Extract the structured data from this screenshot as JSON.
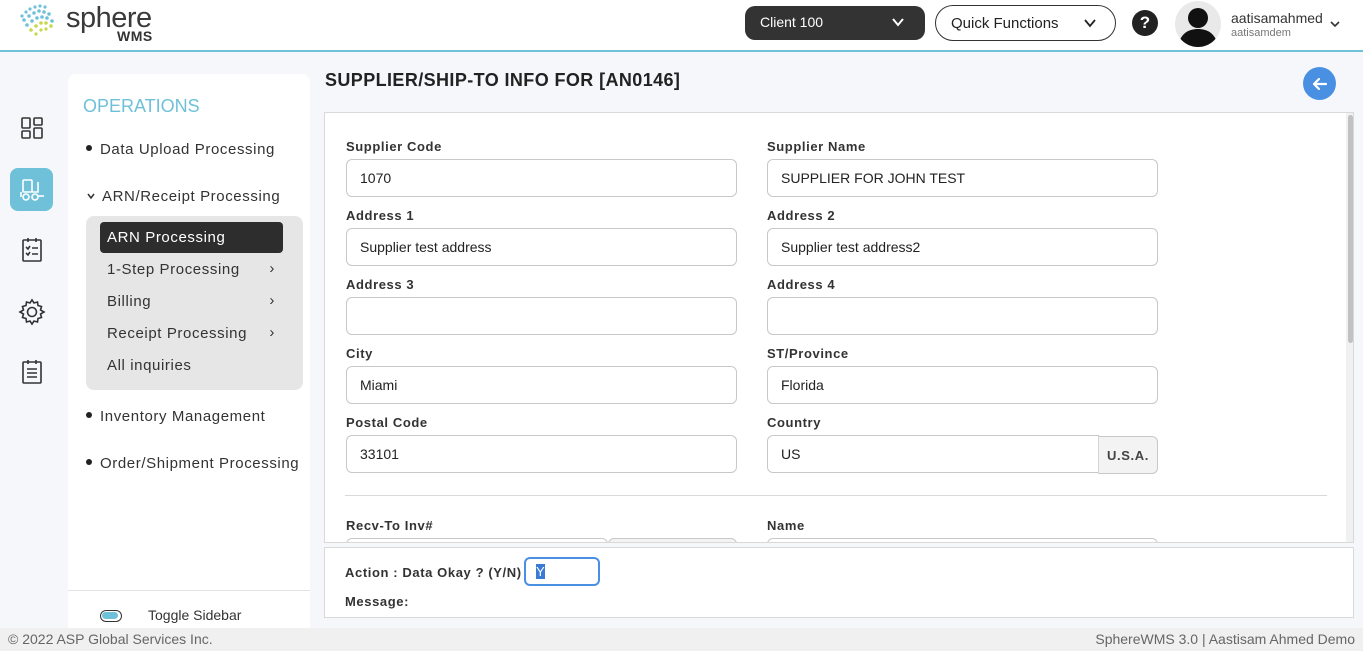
{
  "app": {
    "logo_name": "sphere",
    "logo_sub": "WMS",
    "colors": {
      "accent": "#6ec1d8",
      "dark": "#2d2d2d",
      "link_blue": "#4a90e2"
    }
  },
  "header": {
    "client": "Client 100",
    "quick_functions": "Quick Functions",
    "help": "?",
    "user_name": "aatisamahmed",
    "user_sub": "aatisamdem"
  },
  "rail": {
    "icons": [
      "dashboard-icon",
      "forklift-icon",
      "checklist-icon",
      "gear-icon",
      "report-icon"
    ],
    "active": "forklift-icon"
  },
  "sidebar": {
    "section_title": "OPERATIONS",
    "items": [
      {
        "label": "Data Upload Processing"
      },
      {
        "label": "ARN/Receipt Processing"
      },
      {
        "label": "Inventory Management"
      },
      {
        "label": "Order/Shipment Processing"
      }
    ],
    "subitems": [
      {
        "label": "ARN Processing",
        "active": true
      },
      {
        "label": "1-Step Processing",
        "arrow": "›"
      },
      {
        "label": "Billing",
        "arrow": "›"
      },
      {
        "label": "Receipt Processing",
        "arrow": "›"
      },
      {
        "label": "All inquiries"
      }
    ],
    "toggle_label": "Toggle Sidebar"
  },
  "main": {
    "title": "SUPPLIER/SHIP-TO INFO FOR [AN0146]",
    "fields": {
      "supplier_code": {
        "label": "Supplier Code",
        "value": "1070"
      },
      "supplier_name": {
        "label": "Supplier Name",
        "value": "SUPPLIER FOR JOHN TEST"
      },
      "address1": {
        "label": "Address 1",
        "value": "Supplier test address"
      },
      "address2": {
        "label": "Address 2",
        "value": "Supplier test address2"
      },
      "address3": {
        "label": "Address 3",
        "value": ""
      },
      "address4": {
        "label": "Address 4",
        "value": ""
      },
      "city": {
        "label": "City",
        "value": "Miami"
      },
      "province": {
        "label": "ST/Province",
        "value": "Florida"
      },
      "postal": {
        "label": "Postal Code",
        "value": "33101"
      },
      "country": {
        "label": "Country",
        "value": "US",
        "tag": "U.S.A."
      },
      "recv_inv": {
        "label": "Recv-To Inv#"
      },
      "name": {
        "label": "Name"
      }
    },
    "action": {
      "label": "Action :  Data Okay ? (Y/N)",
      "value": "Y",
      "message_label": "Message:"
    }
  },
  "footer": {
    "left": "© 2022 ASP Global Services Inc.",
    "right": "SphereWMS 3.0 | Aastisam Ahmed Demo"
  }
}
